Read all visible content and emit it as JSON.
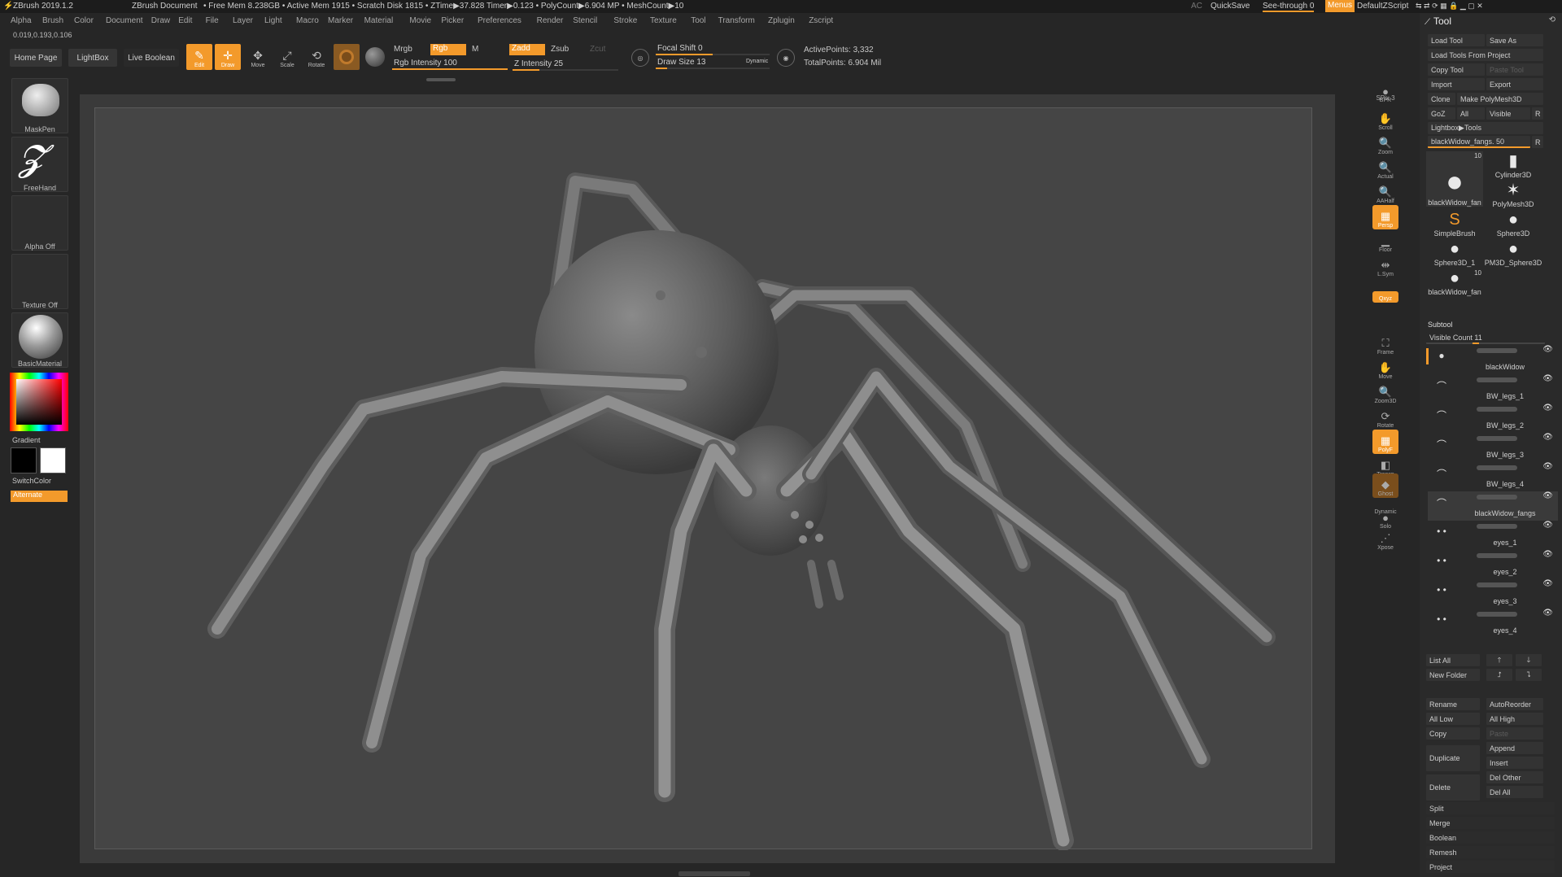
{
  "titlebar": {
    "app": "ZBrush 2019.1.2",
    "doc": "ZBrush Document",
    "stats": "• Free Mem 8.238GB • Active Mem 1915 • Scratch Disk 1815 • ZTime▶37.828 Timer▶0.123 • PolyCount▶6.904 MP • MeshCount▶10",
    "ac": "AC",
    "quicksave": "QuickSave",
    "see_through": "See-through  0",
    "menus": "Menus",
    "default_zscript": "DefaultZScript"
  },
  "menubar": [
    "Alpha",
    "Brush",
    "Color",
    "Document",
    "Draw",
    "Edit",
    "File",
    "Layer",
    "Light",
    "Macro",
    "Marker",
    "Material",
    "Movie",
    "Picker",
    "Preferences",
    "Render",
    "Stencil",
    "Stroke",
    "Texture",
    "Tool",
    "Transform",
    "Zplugin",
    "Zscript"
  ],
  "coords": "0.019,0.193,0.106",
  "topshelf": {
    "home_page": "Home Page",
    "lightbox": "LightBox",
    "live_boolean": "Live Boolean",
    "edit": "Edit",
    "draw": "Draw",
    "move": "Move",
    "scale": "Scale",
    "rotate": "Rotate",
    "mrgb": "Mrgb",
    "rgb": "Rgb",
    "m": "M",
    "rgb_intensity": "Rgb Intensity 100",
    "zadd": "Zadd",
    "zsub": "Zsub",
    "zcut": "Zcut",
    "z_intensity": "Z Intensity 25",
    "focal_shift": "Focal Shift 0",
    "draw_size": "Draw Size 13",
    "dynamic": "Dynamic",
    "active_points": "ActivePoints: 3,332",
    "total_points": "TotalPoints: 6.904 Mil"
  },
  "levels": {
    "rgb_intensity": 1.0,
    "z_intensity": 0.25,
    "focal_shift": 0.5,
    "draw_size": 0.1
  },
  "leftshelf": {
    "brush": "MaskPen",
    "stroke": "FreeHand",
    "alpha": "Alpha Off",
    "texture": "Texture Off",
    "material": "BasicMaterial",
    "gradient": "Gradient",
    "switch_color": "SwitchColor",
    "alternate": "Alternate"
  },
  "rightshelf": [
    "BPR",
    "SPix 3",
    "Scroll",
    "Zoom",
    "Actual",
    "AAHalf",
    "Persp",
    "Floor",
    "L.Sym",
    "",
    "Qxyz",
    "",
    "",
    "Frame",
    "Move",
    "Zoom3D",
    "Rotate",
    "PolyF",
    "Transp",
    "Ghost",
    "Dynamic",
    "Solo",
    "Xpose"
  ],
  "panel": {
    "title": "Tool",
    "load_tool": "Load Tool",
    "save_as": "Save As",
    "load_tools_from_project": "Load Tools From Project",
    "copy_tool": "Copy Tool",
    "paste_tool": "Paste Tool",
    "import": "Import",
    "export": "Export",
    "clone": "Clone",
    "make_polymesh": "Make PolyMesh3D",
    "goz": "GoZ",
    "all": "All",
    "visible": "Visible",
    "r": "R",
    "lightbox_tools": "Lightbox▶Tools",
    "current_tool": "blackWidow_fangs. 50",
    "tools": [
      {
        "label": "blackWidow_fan",
        "count": "10"
      },
      {
        "label": "Cylinder3D",
        "count": ""
      },
      {
        "label": "PolyMesh3D",
        "count": ""
      },
      {
        "label": "SimpleBrush",
        "count": ""
      },
      {
        "label": "Sphere3D",
        "count": ""
      },
      {
        "label": "Sphere3D_1",
        "count": ""
      },
      {
        "label": "PM3D_Sphere3D",
        "count": ""
      },
      {
        "label": "blackWidow_fan",
        "count": "10"
      }
    ],
    "subtool_title": "Subtool",
    "visible_count": "Visible Count 11",
    "subtools": [
      "blackWidow",
      "BW_legs_1",
      "BW_legs_2",
      "BW_legs_3",
      "BW_legs_4",
      "blackWidow_fangs",
      "eyes_1",
      "eyes_2",
      "eyes_3",
      "eyes_4"
    ],
    "list_all": "List All",
    "new_folder": "New Folder",
    "rename": "Rename",
    "auto_reorder": "AutoReorder",
    "all_low": "All Low",
    "all_high": "All High",
    "copy": "Copy",
    "paste": "Paste",
    "append": "Append",
    "insert": "Insert",
    "duplicate": "Duplicate",
    "del_other": "Del Other",
    "delete": "Delete",
    "del_all": "Del All",
    "split": "Split",
    "merge": "Merge",
    "boolean": "Boolean",
    "remesh": "Remesh",
    "project": "Project"
  },
  "colors": {
    "accent": "#f39a2b",
    "background": "#262626",
    "canvas": "#454545"
  }
}
